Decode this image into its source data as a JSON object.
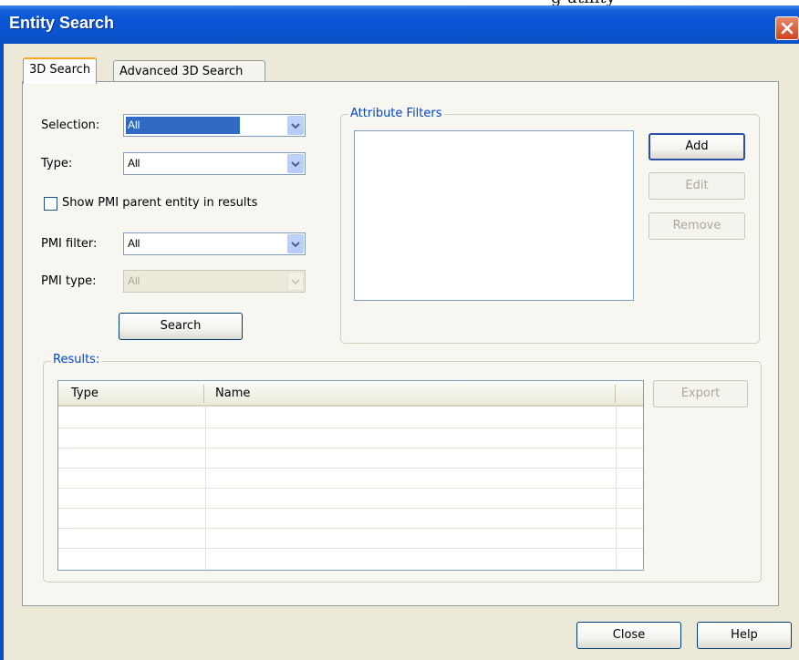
{
  "top_strip": {
    "text": "g utility"
  },
  "window": {
    "title": "Entity Search"
  },
  "tabs": [
    {
      "label": "3D Search",
      "active": true
    },
    {
      "label": "Advanced 3D Search",
      "active": false
    }
  ],
  "form": {
    "selection": {
      "label": "Selection:",
      "value": "All"
    },
    "type": {
      "label": "Type:",
      "value": "All"
    },
    "show_pmi_parent": {
      "label": "Show PMI parent entity in results",
      "checked": false
    },
    "pmi_filter": {
      "label": "PMI filter:",
      "value": "All"
    },
    "pmi_type": {
      "label": "PMI type:",
      "value": "All",
      "disabled": true
    },
    "search_button": "Search"
  },
  "attribute_filters": {
    "legend": "Attribute Filters",
    "buttons": {
      "add": "Add",
      "edit": "Edit",
      "remove": "Remove"
    }
  },
  "results": {
    "legend": "Results:",
    "columns": [
      "Type",
      "Name"
    ],
    "rows": [],
    "export_button": "Export"
  },
  "footer": {
    "close": "Close",
    "help": "Help"
  },
  "icons": {
    "close": "close-x-icon",
    "dropdown": "chevron-down-icon"
  },
  "colors": {
    "titlebar": "#0a55d6",
    "accent": "#316ac5",
    "legend": "#0046d5",
    "tab_highlight": "#f9a824"
  }
}
